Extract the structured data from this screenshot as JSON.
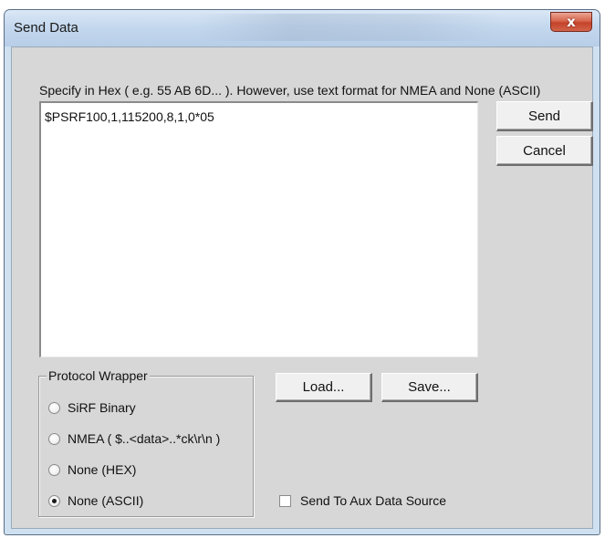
{
  "window": {
    "title": "Send Data",
    "close_glyph": "x"
  },
  "instructions": "Specify in Hex ( e.g. 55 AB 6D... ).  However, use text format for NMEA and None (ASCII)",
  "data_input": {
    "value": "$PSRF100,1,115200,8,1,0*05"
  },
  "buttons": {
    "send": "Send",
    "cancel": "Cancel",
    "load": "Load...",
    "save": "Save..."
  },
  "protocol_wrapper": {
    "legend": "Protocol Wrapper",
    "options": [
      {
        "label": "SiRF Binary",
        "selected": false
      },
      {
        "label": "NMEA ( $..<data>..*ck\\r\\n )",
        "selected": false
      },
      {
        "label": "None (HEX)",
        "selected": false
      },
      {
        "label": "None (ASCII)",
        "selected": true
      }
    ]
  },
  "send_to_aux": {
    "label": "Send To Aux Data Source",
    "checked": false
  },
  "icons": {
    "close": "close-icon",
    "radio": "radio-button-icon",
    "checkbox": "checkbox-icon"
  }
}
